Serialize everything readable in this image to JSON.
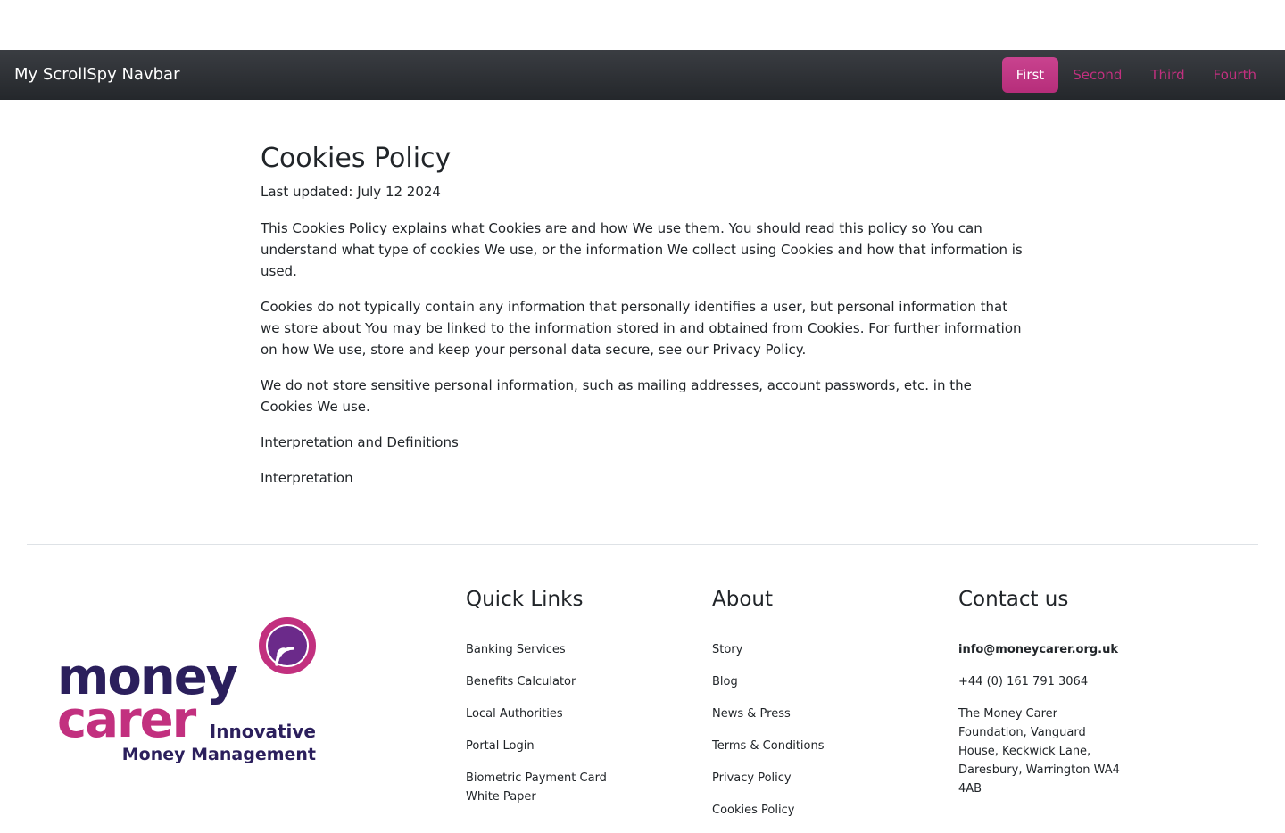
{
  "navbar": {
    "brand": "My ScrollSpy Navbar",
    "links": [
      {
        "label": "First",
        "active": true
      },
      {
        "label": "Second",
        "active": false
      },
      {
        "label": "Third",
        "active": false
      },
      {
        "label": "Fourth",
        "active": false
      }
    ]
  },
  "content": {
    "title": "Cookies Policy",
    "updated": "Last updated: July 12 2024",
    "paragraphs": [
      "This Cookies Policy explains what Cookies are and how We use them. You should read this policy so You can understand what type of cookies We use, or the information We collect using Cookies and how that information is used.",
      "Cookies do not typically contain any information that personally identifies a user, but personal information that we store about You may be linked to the information stored in and obtained from Cookies. For further information on how We use, store and keep your personal data secure, see our Privacy Policy.",
      "We do not store sensitive personal information, such as mailing addresses, account passwords, etc. in the Cookies We use.",
      "Interpretation and Definitions",
      "Interpretation"
    ]
  },
  "footer": {
    "logo": {
      "line1": "money",
      "line2": "carer",
      "tagline1": "Innovative",
      "tagline2": "Money Management",
      "colors": {
        "navy": "#2b1f5c",
        "magenta": "#c2307f",
        "purple": "#6b2a8a"
      }
    },
    "quick_links": {
      "heading": "Quick Links",
      "items": [
        "Banking Services",
        "Benefits Calculator",
        "Local Authorities",
        "Portal Login",
        "Biometric Payment Card White Paper"
      ]
    },
    "about": {
      "heading": "About",
      "items": [
        "Story",
        "Blog",
        "News & Press",
        "Terms & Conditions",
        "Privacy Policy",
        "Cookies Policy"
      ]
    },
    "contact": {
      "heading": "Contact us",
      "email": "info@moneycarer.org.uk",
      "phone": "+44 (0) 161  791 3064",
      "address": "The Money Carer Foundation, Vanguard House, Keckwick Lane, Daresbury, Warrington WA4 4AB"
    }
  }
}
